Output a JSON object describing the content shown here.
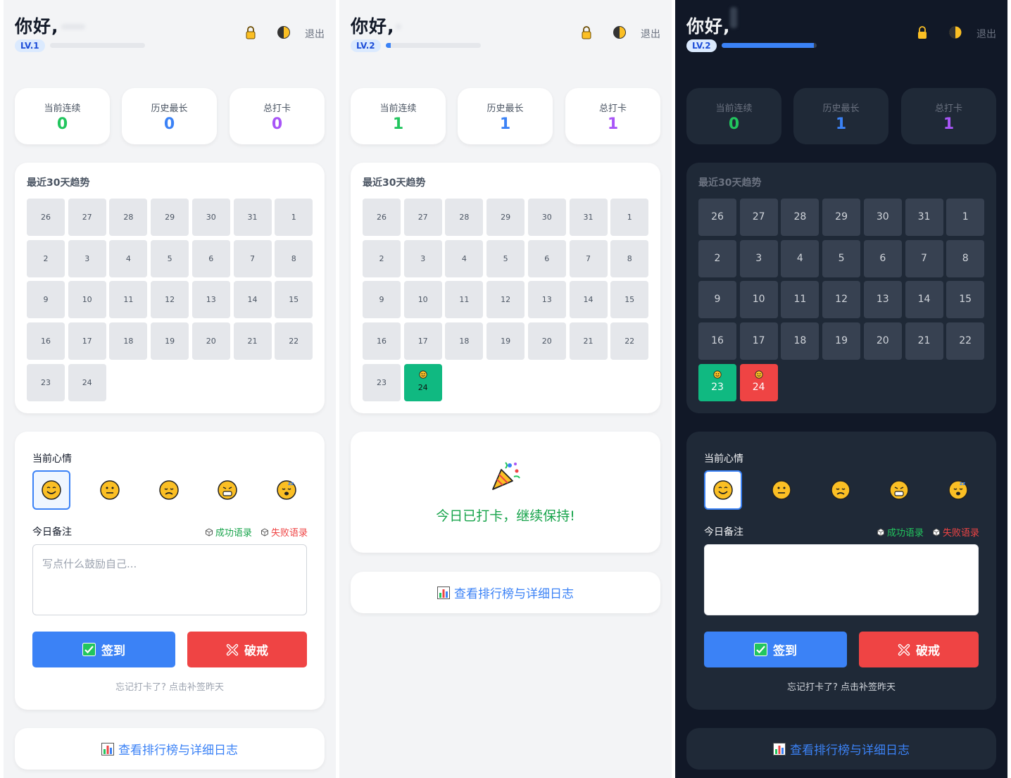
{
  "header": {
    "greeting": "你好,",
    "logout": "退出"
  },
  "stat_labels": {
    "current": "当前连续",
    "longest": "历史最长",
    "total": "总打卡"
  },
  "trend_title": "最近30天趋势",
  "days": [
    "26",
    "27",
    "28",
    "29",
    "30",
    "31",
    "1",
    "2",
    "3",
    "4",
    "5",
    "6",
    "7",
    "8",
    "9",
    "10",
    "11",
    "12",
    "13",
    "14",
    "15",
    "16",
    "17",
    "18",
    "19",
    "20",
    "21",
    "22",
    "23",
    "24"
  ],
  "mood_title": "当前心情",
  "note_title": "今日备注",
  "success_lines": "成功语录",
  "fail_lines": "失败语录",
  "note_placeholder": "写点什么鼓励自己...",
  "checkin_label": "签到",
  "break_label": "破戒",
  "makeup_text": "忘记打卡了? 点击补签昨天",
  "checked_in_text": "今日已打卡，继续保持!",
  "leaderboard_link": "查看排行榜与详细日志",
  "panels": [
    {
      "level": "LV.1",
      "xp_fraction": 0.0,
      "stats": {
        "current": "0",
        "longest": "0",
        "total": "0"
      },
      "marks": {}
    },
    {
      "level": "LV.2",
      "xp_fraction": 0.05,
      "stats": {
        "current": "1",
        "longest": "1",
        "total": "1"
      },
      "marks": {
        "24": "green"
      }
    },
    {
      "level": "LV.2",
      "xp_fraction": 0.97,
      "stats": {
        "current": "0",
        "longest": "1",
        "total": "1"
      },
      "marks": {
        "23": "green",
        "24": "red"
      }
    }
  ],
  "colors": {
    "current": "#22c55e",
    "longest": "#3b82f6",
    "total": "#a855f7",
    "primary": "#3b82f6",
    "danger": "#ef4444",
    "success": "#10b981"
  },
  "icons": {
    "lock": "lock-icon",
    "theme": "half-moon-icon",
    "dice": "dice-icon",
    "chart": "bar-chart-icon",
    "party": "party-popper-icon",
    "check": "check-box-icon",
    "cross": "cross-icon"
  }
}
